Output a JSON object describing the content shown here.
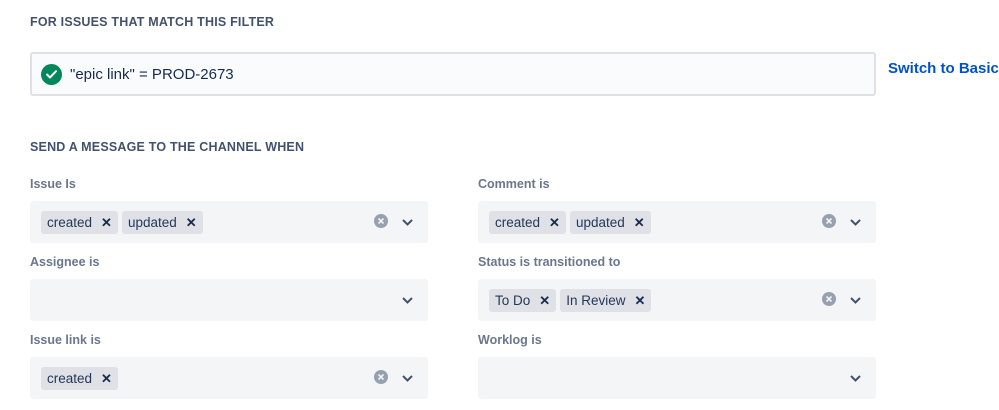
{
  "filter": {
    "section_title": "FOR ISSUES THAT MATCH THIS FILTER",
    "jql_query": "\"epic link\" = PROD-2673",
    "switch_link": "Switch to Basic"
  },
  "send": {
    "section_title": "SEND A MESSAGE TO THE CHANNEL WHEN"
  },
  "fields": {
    "issue_is": {
      "label": "Issue Is",
      "tags": [
        "created",
        "updated"
      ]
    },
    "comment_is": {
      "label": "Comment is",
      "tags": [
        "created",
        "updated"
      ]
    },
    "assignee_is": {
      "label": "Assignee is",
      "tags": []
    },
    "status_transitioned": {
      "label": "Status is transitioned to",
      "tags": [
        "To Do",
        "In Review"
      ]
    },
    "issue_link_is": {
      "label": "Issue link is",
      "tags": [
        "created"
      ]
    },
    "worklog_is": {
      "label": "Worklog is",
      "tags": []
    }
  },
  "colors": {
    "link": "#0052cc",
    "success": "#00875a",
    "heading": "#42526e",
    "label": "#6b778c"
  }
}
